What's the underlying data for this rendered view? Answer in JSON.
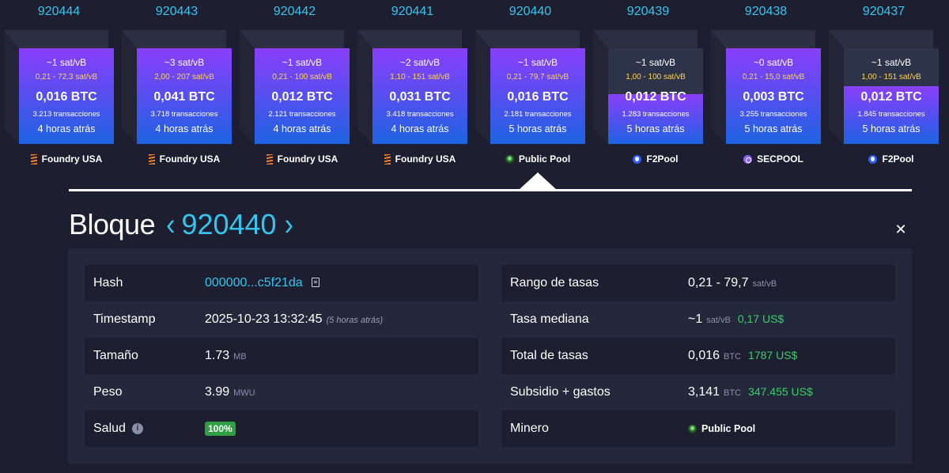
{
  "blocks": [
    {
      "height": "920444",
      "median_fee": "~1 sat/vB",
      "fee_range": "0,21 - 72,3 sat/vB",
      "total_fees": "0,016 BTC",
      "tx_count": "3.213 transacciones",
      "time_ago": "4 horas atrás",
      "miner": "Foundry USA",
      "miner_icon": "foundry-icon",
      "fill_percent": 100
    },
    {
      "height": "920443",
      "median_fee": "~3 sat/vB",
      "fee_range": "2,00 - 207 sat/vB",
      "total_fees": "0,041 BTC",
      "tx_count": "3.718 transacciones",
      "time_ago": "4 horas atrás",
      "miner": "Foundry USA",
      "miner_icon": "foundry-icon",
      "fill_percent": 100
    },
    {
      "height": "920442",
      "median_fee": "~1 sat/vB",
      "fee_range": "0,21 - 100 sat/vB",
      "total_fees": "0,012 BTC",
      "tx_count": "2.121 transacciones",
      "time_ago": "4 horas atrás",
      "miner": "Foundry USA",
      "miner_icon": "foundry-icon",
      "fill_percent": 100
    },
    {
      "height": "920441",
      "median_fee": "~2 sat/vB",
      "fee_range": "1,10 - 151 sat/vB",
      "total_fees": "0,031 BTC",
      "tx_count": "3.418 transacciones",
      "time_ago": "4 horas atrás",
      "miner": "Foundry USA",
      "miner_icon": "foundry-icon",
      "fill_percent": 100
    },
    {
      "height": "920440",
      "median_fee": "~1 sat/vB",
      "fee_range": "0,21 - 79,7 sat/vB",
      "total_fees": "0,016 BTC",
      "tx_count": "2.181 transacciones",
      "time_ago": "5 horas atrás",
      "miner": "Public Pool",
      "miner_icon": "public-pool-icon",
      "fill_percent": 100
    },
    {
      "height": "920439",
      "median_fee": "~1 sat/vB",
      "fee_range": "1,00 - 100 sat/vB",
      "total_fees": "0,012 BTC",
      "tx_count": "1.283 transacciones",
      "time_ago": "5 horas atrás",
      "miner": "F2Pool",
      "miner_icon": "f2pool-icon",
      "fill_percent": 52
    },
    {
      "height": "920438",
      "median_fee": "~0 sat/vB",
      "fee_range": "0,21 - 15,0 sat/vB",
      "total_fees": "0,003 BTC",
      "tx_count": "3.255 transacciones",
      "time_ago": "5 horas atrás",
      "miner": "SECPOOL",
      "miner_icon": "secpool-icon",
      "fill_percent": 100
    },
    {
      "height": "920437",
      "median_fee": "~1 sat/vB",
      "fee_range": "1,00 - 151 sat/vB",
      "total_fees": "0,012 BTC",
      "tx_count": "1.845 transacciones",
      "time_ago": "5 horas atrás",
      "miner": "F2Pool",
      "miner_icon": "f2pool-icon",
      "fill_percent": 60
    }
  ],
  "header": {
    "title": "Bloque",
    "prev_glyph": "‹",
    "height": "920440",
    "next_glyph": "›",
    "close_glyph": "✕"
  },
  "details": {
    "left": {
      "hash_label": "Hash",
      "hash_value": "000000...c5f21da",
      "timestamp_label": "Timestamp",
      "timestamp_value": "2025-10-23 13:32:45",
      "timestamp_ago": "(5 horas atrás)",
      "size_label": "Tamaño",
      "size_value": "1.73",
      "size_unit": "MB",
      "weight_label": "Peso",
      "weight_value": "3.99",
      "weight_unit": "MWU",
      "health_label": "Salud",
      "health_info_glyph": "i",
      "health_value": "100%"
    },
    "right": {
      "fee_range_label": "Rango de tasas",
      "fee_range_value": "0,21 - 79,7",
      "fee_range_unit": "sat/vB",
      "median_label": "Tasa mediana",
      "median_value": "~1",
      "median_unit": "sat/vB",
      "median_usd": "0,17 US$",
      "total_fees_label": "Total de tasas",
      "total_fees_value": "0,016",
      "total_fees_unit": "BTC",
      "total_fees_usd": "1787 US$",
      "subsidy_label": "Subsidio + gastos",
      "subsidy_value": "3,141",
      "subsidy_unit": "BTC",
      "subsidy_usd": "347.455 US$",
      "miner_label": "Minero",
      "miner_value": "Public Pool",
      "miner_icon": "public-pool-icon"
    }
  },
  "colors": {
    "background": "#1d1f31",
    "panel": "#24283b",
    "accent": "#36c4ee",
    "fee_range_text": "#ffd34a",
    "usd_green": "#3bcc6a",
    "health_badge": "#2ea043",
    "block_gradient_top": "#8a3ffc",
    "block_gradient_bottom": "#1d63e2"
  }
}
